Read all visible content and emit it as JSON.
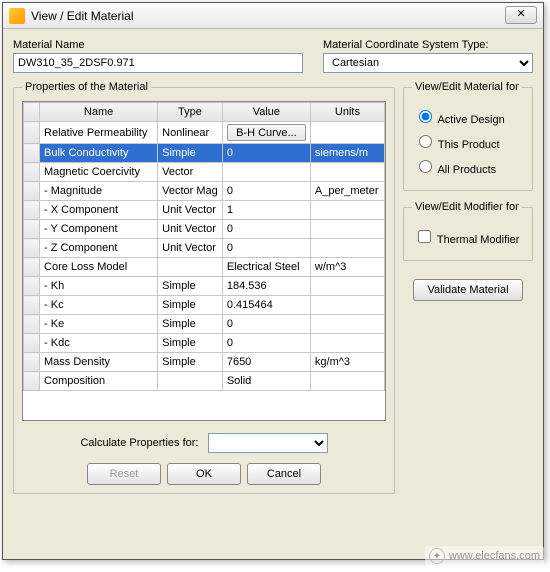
{
  "window": {
    "title": "View / Edit Material",
    "close_glyph": "✕"
  },
  "material_name": {
    "label": "Material Name",
    "value": "DW310_35_2DSF0.971"
  },
  "coord_system": {
    "label": "Material Coordinate System Type:",
    "value": "Cartesian"
  },
  "properties": {
    "legend": "Properties of the Material",
    "headers": {
      "name": "Name",
      "type": "Type",
      "value": "Value",
      "units": "Units"
    },
    "rows": [
      {
        "name": "Relative Permeability",
        "type": "Nonlinear",
        "value_btn": "B-H Curve...",
        "units": ""
      },
      {
        "name": "Bulk Conductivity",
        "type": "Simple",
        "value": "0",
        "units": "siemens/m",
        "selected": true
      },
      {
        "name": "Magnetic Coercivity",
        "type": "Vector",
        "value": "",
        "units": ""
      },
      {
        "name": "- Magnitude",
        "type": "Vector Mag",
        "value": "0",
        "units": "A_per_meter"
      },
      {
        "name": "- X Component",
        "type": "Unit Vector",
        "value": "1",
        "units": ""
      },
      {
        "name": "- Y Component",
        "type": "Unit Vector",
        "value": "0",
        "units": ""
      },
      {
        "name": "- Z Component",
        "type": "Unit Vector",
        "value": "0",
        "units": ""
      },
      {
        "name": "Core Loss Model",
        "type": "",
        "value": "Electrical Steel",
        "units": "w/m^3"
      },
      {
        "name": "- Kh",
        "type": "Simple",
        "value": "184.536",
        "units": ""
      },
      {
        "name": "- Kc",
        "type": "Simple",
        "value": "0.415464",
        "units": ""
      },
      {
        "name": "- Ke",
        "type": "Simple",
        "value": "0",
        "units": ""
      },
      {
        "name": "- Kdc",
        "type": "Simple",
        "value": "0",
        "units": ""
      },
      {
        "name": "Mass Density",
        "type": "Simple",
        "value": "7650",
        "units": "kg/m^3"
      },
      {
        "name": "Composition",
        "type": "",
        "value": "Solid",
        "units": ""
      }
    ]
  },
  "view_for": {
    "legend": "View/Edit Material for",
    "opts": {
      "active": "Active Design",
      "product": "This Product",
      "all": "All Products"
    },
    "selected": "active"
  },
  "modifier_for": {
    "legend": "View/Edit Modifier for",
    "thermal": "Thermal Modifier",
    "thermal_checked": false
  },
  "buttons": {
    "validate": "Validate Material",
    "calc_label": "Calculate Properties for:",
    "calc_value": "",
    "reset": "Reset",
    "ok": "OK",
    "cancel": "Cancel"
  },
  "watermark": "www.elecfans.com"
}
